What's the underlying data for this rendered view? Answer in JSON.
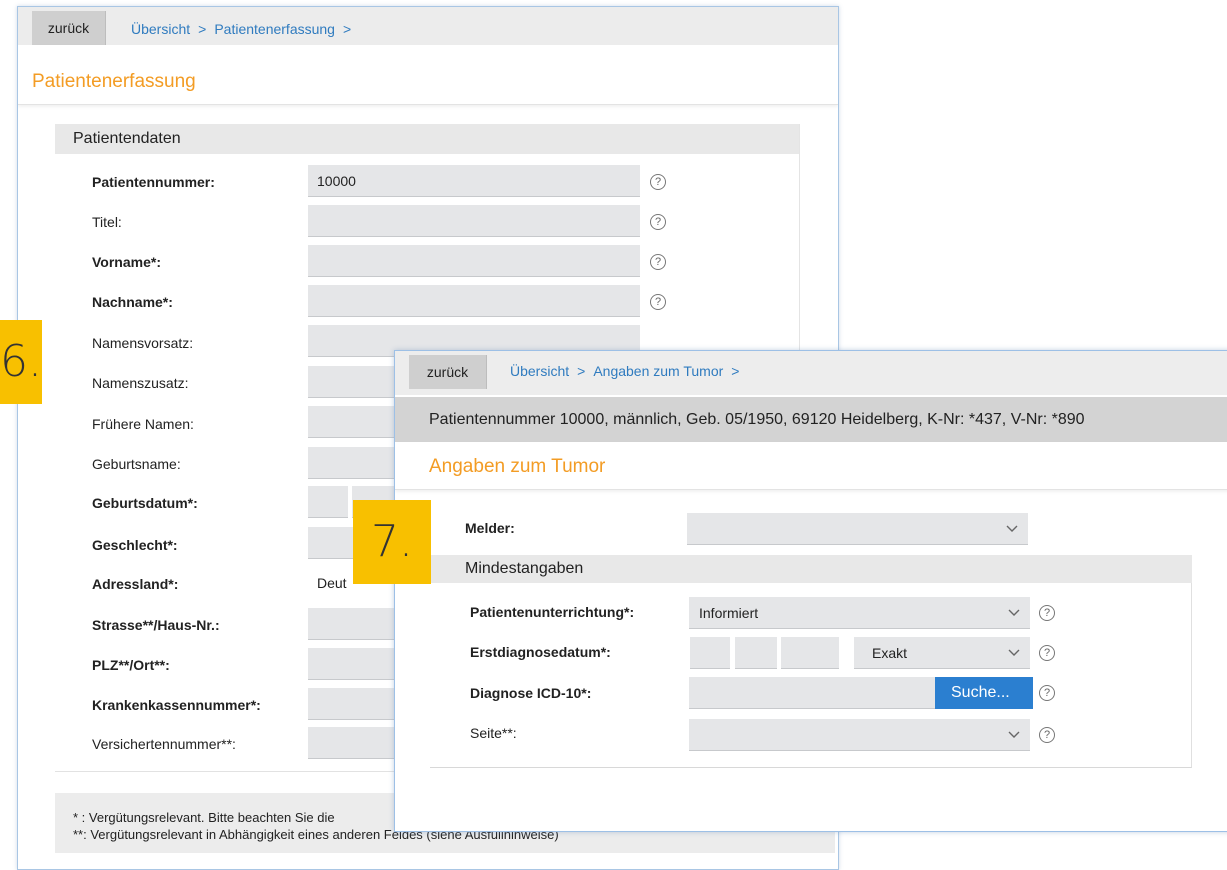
{
  "window1": {
    "back_label": "zurück",
    "breadcrumb": [
      "Übersicht",
      "Patientenerfassung"
    ],
    "breadcrumb_sep": ">",
    "page_title": "Patientenerfassung",
    "section_title": "Patientendaten",
    "fields": [
      {
        "label": "Patientennummer:",
        "value": "10000"
      },
      {
        "label": "Titel:",
        "value": ""
      },
      {
        "label": "Vorname*:",
        "value": ""
      },
      {
        "label": "Nachname*:",
        "value": ""
      },
      {
        "label": "Namensvorsatz:",
        "value": ""
      },
      {
        "label": "Namenszusatz:",
        "value": ""
      },
      {
        "label": "Frühere Namen:",
        "value": ""
      },
      {
        "label": "Geburtsname:",
        "value": ""
      },
      {
        "label": "Geburtsdatum*:",
        "value": ""
      },
      {
        "label": "Geschlecht*:",
        "value": ""
      },
      {
        "label": "Adressland*:",
        "value": "Deut"
      },
      {
        "label": "Strasse**/Haus-Nr.:",
        "value": ""
      },
      {
        "label": "PLZ**/Ort**:",
        "value": ""
      },
      {
        "label": "Krankenkassennummer*:",
        "value": ""
      },
      {
        "label": "Versichertennummer**:",
        "value": ""
      }
    ],
    "help_glyph": "?",
    "footer_line1": "* : Vergütungsrelevant. Bitte beachten Sie die",
    "footer_line2": "**: Vergütungsrelevant in Abhängigkeit eines anderen Feldes (siehe Ausfüllhinweise)"
  },
  "window2": {
    "back_label": "zurück",
    "breadcrumb": [
      "Übersicht",
      "Angaben zum Tumor"
    ],
    "breadcrumb_sep": ">",
    "patient_info": "Patientennummer 10000, männlich, Geb. 05/1950, 69120 Heidelberg, K-Nr: *437, V-Nr: *890",
    "page_title": "Angaben zum Tumor",
    "melder_label": "Melder:",
    "melder_value": "",
    "section_title": "Mindestangaben",
    "unterrichtung_label": "Patientenunterrichtung*:",
    "unterrichtung_value": "Informiert",
    "erstdiagnose_label": "Erstdiagnosedatum*:",
    "erstdiagnose_precision": "Exakt",
    "diagnose_label": "Diagnose ICD-10*:",
    "diagnose_value": "",
    "search_button": "Suche...",
    "seite_label": "Seite**:",
    "seite_value": ""
  },
  "badges": {
    "badge_6": "6.",
    "badge_7": "7."
  },
  "colors": {
    "accent_orange": "#f39c24",
    "link_blue": "#2f7bbf",
    "button_blue": "#2b7fd0",
    "badge_yellow": "#f8c000"
  },
  "icons": [
    "help-circle-icon",
    "chevron-down-icon",
    "breadcrumb-chevron-icon"
  ]
}
